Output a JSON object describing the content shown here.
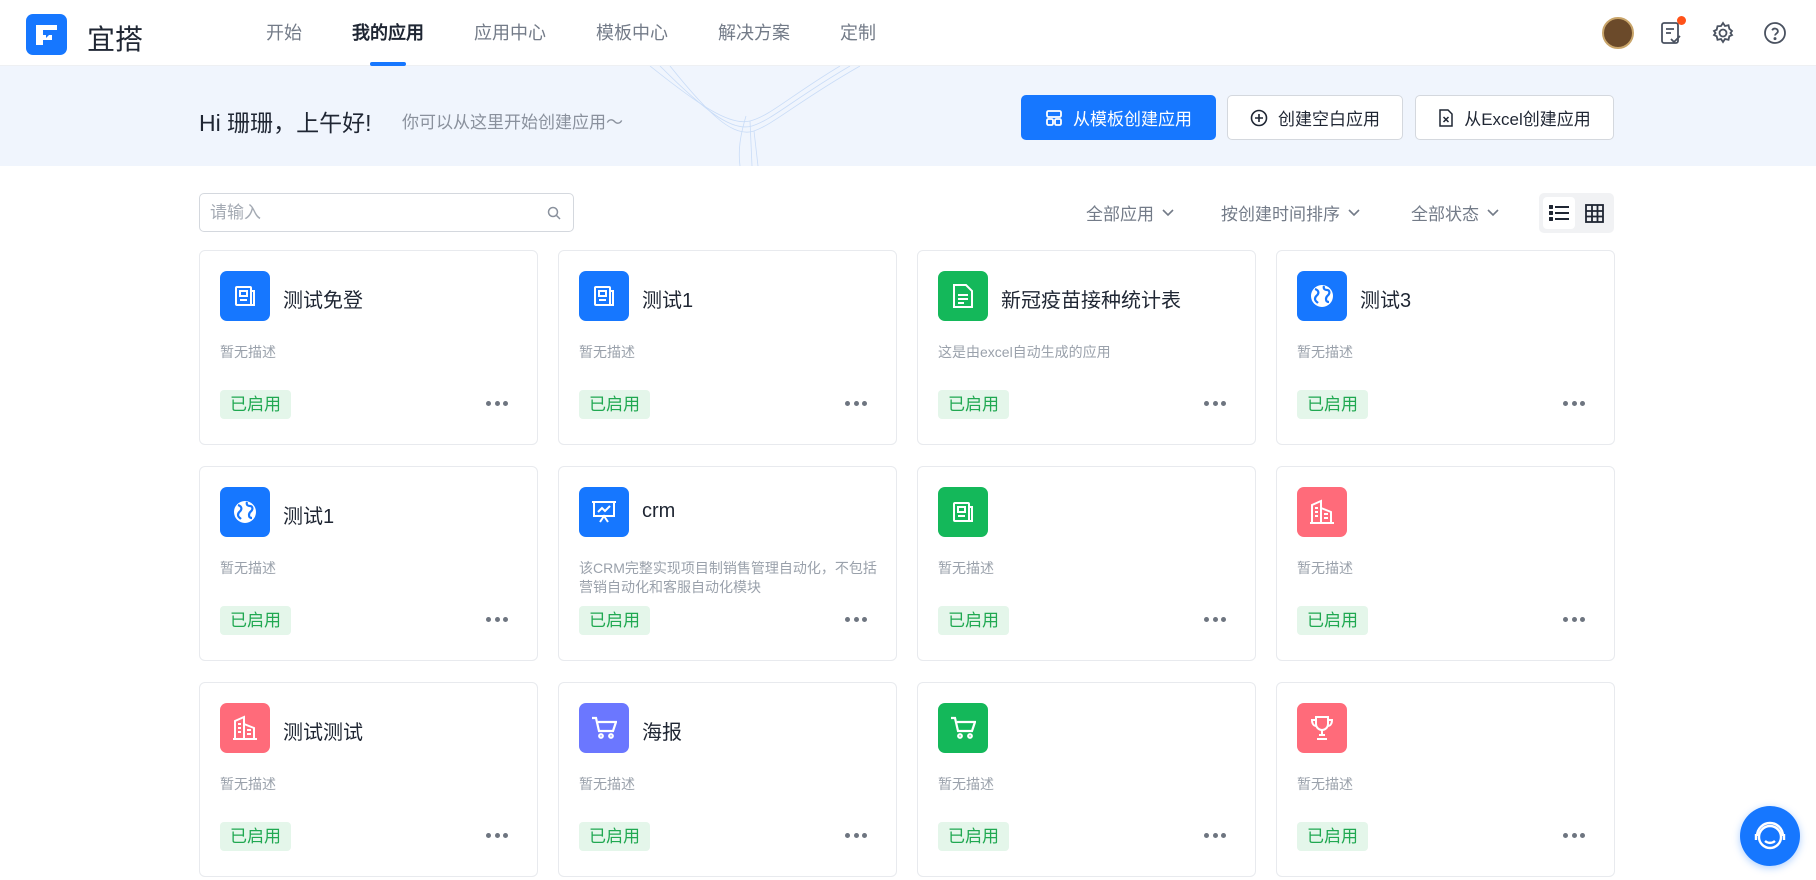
{
  "app": {
    "brand": "宜搭"
  },
  "nav": {
    "items": [
      {
        "label": "开始",
        "active": false
      },
      {
        "label": "我的应用",
        "active": true
      },
      {
        "label": "应用中心",
        "active": false
      },
      {
        "label": "模板中心",
        "active": false
      },
      {
        "label": "解决方案",
        "active": false
      },
      {
        "label": "定制",
        "active": false
      }
    ],
    "icons": [
      "avatar",
      "todo-icon",
      "gear-icon",
      "help-icon"
    ],
    "notification_dot_color": "#ff5219"
  },
  "banner": {
    "greeting": "Hi 珊珊，上午好!",
    "subtitle": "你可以从这里开始创建应用～",
    "buttons": {
      "from_template": "从模板创建应用",
      "blank": "创建空白应用",
      "from_excel": "从Excel创建应用"
    }
  },
  "toolbar": {
    "search_placeholder": "请输入",
    "filter_apps": "全部应用",
    "sort": "按创建时间排序",
    "filter_status": "全部状态",
    "view_mode": "list"
  },
  "colors": {
    "accent": "#1677ff",
    "green": "#14b85a",
    "red": "#ff6b7a",
    "purple": "#6b77ff",
    "status_text": "#20a851",
    "status_bg": "#e4f6ea"
  },
  "apps": [
    {
      "name": "测试免登",
      "desc": "暂无描述",
      "status": "已启用",
      "icon": "form-icon",
      "color": "#1677ff"
    },
    {
      "name": "测试1",
      "desc": "暂无描述",
      "status": "已启用",
      "icon": "form-icon",
      "color": "#1677ff"
    },
    {
      "name": "新冠疫苗接种统计表",
      "desc": "这是由excel自动生成的应用",
      "status": "已启用",
      "icon": "document-icon",
      "color": "#14b85a"
    },
    {
      "name": "测试3",
      "desc": "暂无描述",
      "status": "已启用",
      "icon": "globe-icon",
      "color": "#1677ff"
    },
    {
      "name": "测试1",
      "desc": "暂无描述",
      "status": "已启用",
      "icon": "globe-icon",
      "color": "#1677ff"
    },
    {
      "name": "crm",
      "desc": "该CRM完整实现项目制销售管理自动化，不包括营销自动化和客服自动化模块",
      "status": "已启用",
      "icon": "presentation-icon",
      "color": "#1677ff"
    },
    {
      "name": "",
      "desc": "暂无描述",
      "status": "已启用",
      "icon": "form-icon",
      "color": "#14b85a"
    },
    {
      "name": "",
      "desc": "暂无描述",
      "status": "已启用",
      "icon": "building-icon",
      "color": "#ff6b7a"
    },
    {
      "name": "测试测试",
      "desc": "暂无描述",
      "status": "已启用",
      "icon": "building-icon",
      "color": "#ff6b7a"
    },
    {
      "name": "海报",
      "desc": "暂无描述",
      "status": "已启用",
      "icon": "cart-icon",
      "color": "#6b77ff"
    },
    {
      "name": "",
      "desc": "暂无描述",
      "status": "已启用",
      "icon": "cart-icon",
      "color": "#14b85a"
    },
    {
      "name": "",
      "desc": "暂无描述",
      "status": "已启用",
      "icon": "trophy-icon",
      "color": "#ff6b7a"
    }
  ]
}
